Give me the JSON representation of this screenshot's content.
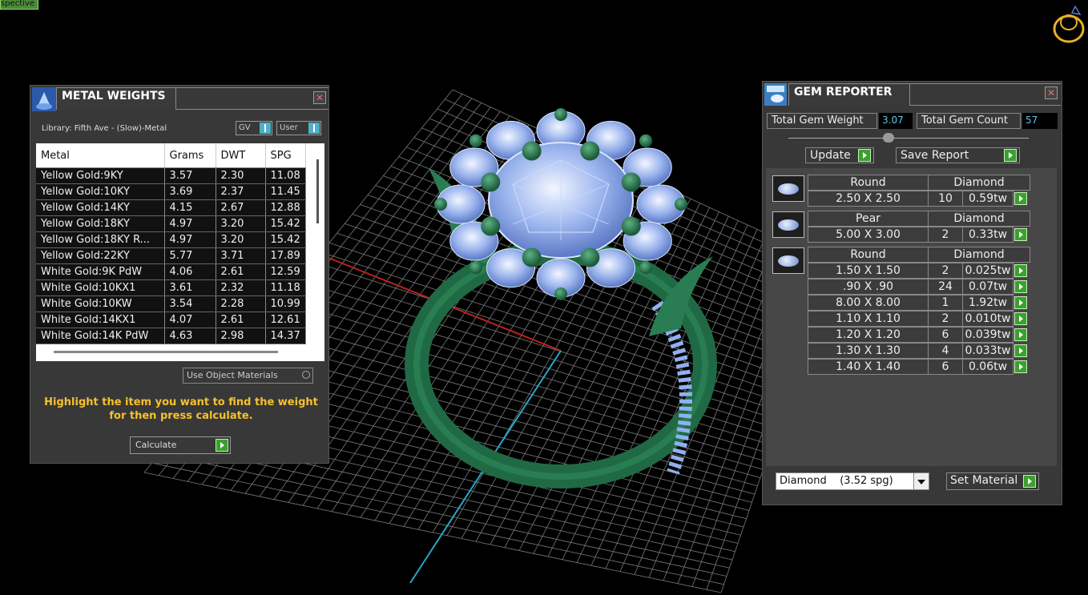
{
  "viewport": {
    "label": "spective"
  },
  "metal_weights": {
    "title": "METAL WEIGHTS",
    "library": "Library: Fifth Ave - (Slow)-Metal",
    "gv_label": "GV",
    "user_label": "User",
    "columns": [
      "Metal",
      "Grams",
      "DWT",
      "SPG"
    ],
    "rows": [
      [
        "Yellow Gold:9KY",
        "3.57",
        "2.30",
        "11.08"
      ],
      [
        "Yellow Gold:10KY",
        "3.69",
        "2.37",
        "11.45"
      ],
      [
        "Yellow Gold:14KY",
        "4.15",
        "2.67",
        "12.88"
      ],
      [
        "Yellow Gold:18KY",
        "4.97",
        "3.20",
        "15.42"
      ],
      [
        "Yellow Gold:18KY R...",
        "4.97",
        "3.20",
        "15.42"
      ],
      [
        "Yellow Gold:22KY",
        "5.77",
        "3.71",
        "17.89"
      ],
      [
        "White Gold:9K PdW",
        "4.06",
        "2.61",
        "12.59"
      ],
      [
        "White Gold:10KX1",
        "3.61",
        "2.32",
        "11.18"
      ],
      [
        "White Gold:10KW",
        "3.54",
        "2.28",
        "10.99"
      ],
      [
        "White Gold:14KX1",
        "4.07",
        "2.61",
        "12.61"
      ],
      [
        "White Gold:14K PdW",
        "4.63",
        "2.98",
        "14.37"
      ]
    ],
    "use_object_materials": "Use Object Materials",
    "hint": "Highlight the item you want to find the weight for then press calculate.",
    "calculate_label": "Calculate"
  },
  "gem_reporter": {
    "title": "GEM REPORTER",
    "total_weight_label": "Total Gem Weight",
    "total_weight_value": "3.07",
    "total_count_label": "Total Gem Count",
    "total_count_value": "57",
    "update_label": "Update",
    "save_report_label": "Save Report",
    "groups": [
      {
        "shape": "Round",
        "material": "Diamond",
        "items": [
          {
            "size": "2.50 X 2.50",
            "count": "10",
            "tw": "0.59tw"
          }
        ]
      },
      {
        "shape": "Pear",
        "material": "Diamond",
        "items": [
          {
            "size": "5.00 X 3.00",
            "count": "2",
            "tw": "0.33tw"
          }
        ]
      },
      {
        "shape": "Round",
        "material": "Diamond",
        "items": [
          {
            "size": "1.50 X 1.50",
            "count": "2",
            "tw": "0.025tw"
          },
          {
            "size": ".90 X .90",
            "count": "24",
            "tw": "0.07tw"
          },
          {
            "size": "8.00 X 8.00",
            "count": "1",
            "tw": "1.92tw"
          },
          {
            "size": "1.10 X 1.10",
            "count": "2",
            "tw": "0.010tw"
          },
          {
            "size": "1.20 X 1.20",
            "count": "6",
            "tw": "0.039tw"
          },
          {
            "size": "1.30 X 1.30",
            "count": "4",
            "tw": "0.033tw"
          },
          {
            "size": "1.40 X 1.40",
            "count": "6",
            "tw": "0.06tw"
          }
        ]
      }
    ],
    "material_select": "Diamond    (3.52 spg)",
    "set_material_label": "Set Material"
  }
}
